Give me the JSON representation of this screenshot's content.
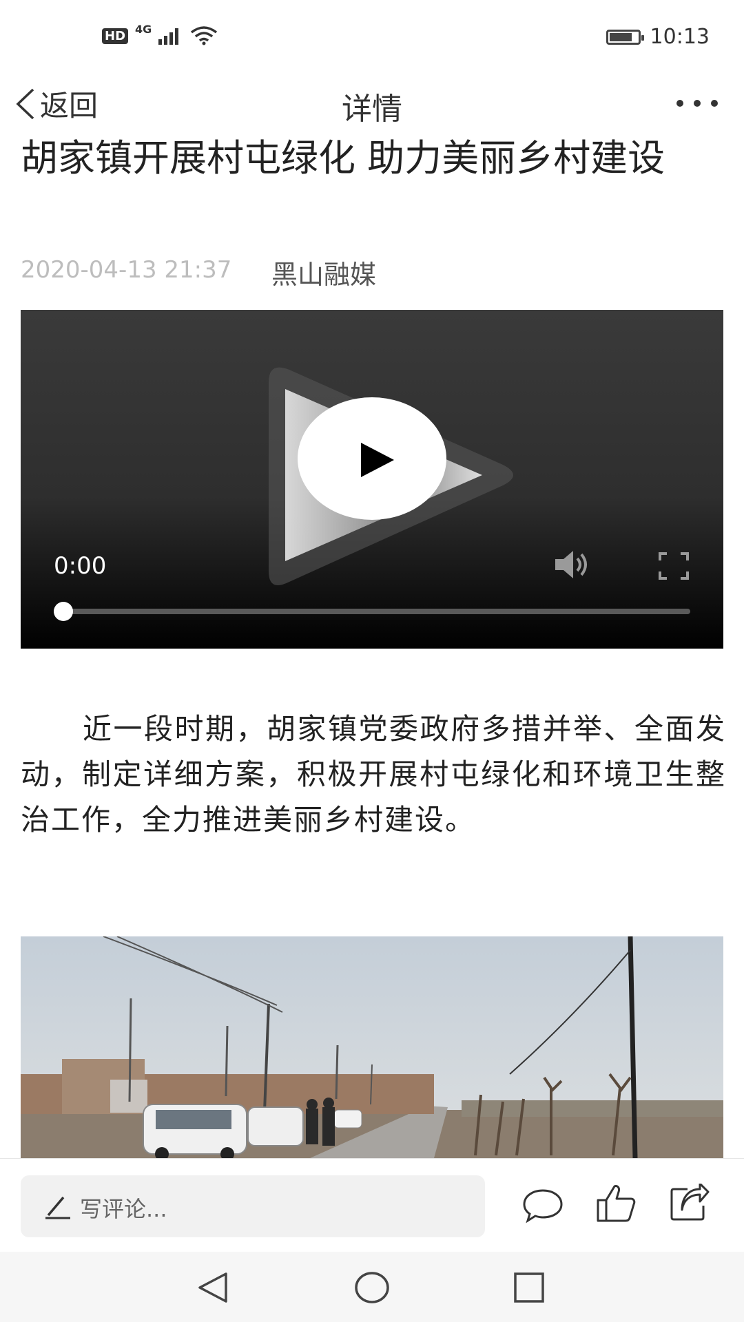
{
  "status_bar": {
    "hd_badge": "HD",
    "network": "4G",
    "time": "10:13",
    "battery_level": 0.7
  },
  "header": {
    "back_label": "返回",
    "title": "详情"
  },
  "article": {
    "title": "胡家镇开展村屯绿化 助力美丽乡村建设",
    "datetime": "2020-04-13 21:37",
    "source": "黑山融媒",
    "body": "近一段时期，胡家镇党委政府多措并举、全面发动，制定详细方案，积极开展村屯绿化和环境卫生整治工作，全力推进美丽乡村建设。"
  },
  "video": {
    "current_time": "0:00",
    "progress": 0
  },
  "comment_bar": {
    "placeholder": "写评论..."
  },
  "icons": {
    "back": "chevron-left-icon",
    "more": "more-dots-icon",
    "play": "play-icon",
    "volume": "volume-icon",
    "fullscreen": "fullscreen-icon",
    "pencil": "pencil-icon",
    "comment": "comment-icon",
    "like": "thumbs-up-icon",
    "share": "share-icon",
    "nav_back": "triangle-back-icon",
    "nav_home": "circle-home-icon",
    "nav_recent": "square-recent-icon"
  }
}
